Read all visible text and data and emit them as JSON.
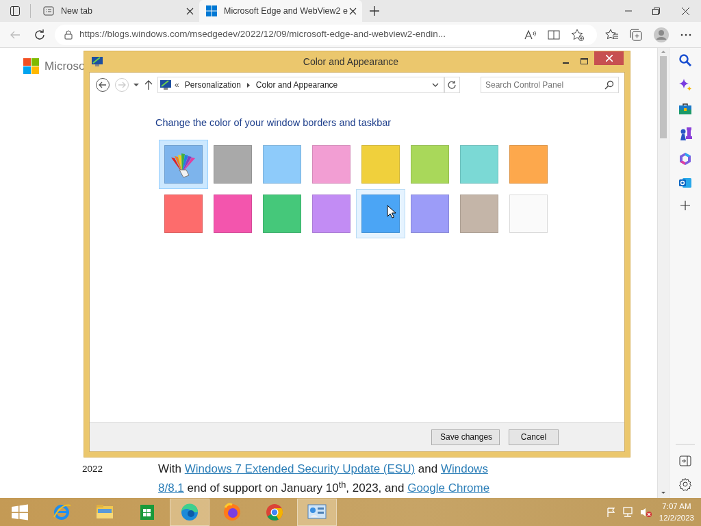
{
  "browser": {
    "tabs": [
      {
        "title": "New tab",
        "selected": false
      },
      {
        "title": "Microsoft Edge and WebView2 e",
        "selected": true
      }
    ],
    "url": "https://blogs.windows.com/msedgedev/2022/12/09/microsoft-edge-and-webview2-endin..."
  },
  "page": {
    "logo_text": "Microso",
    "date": "2022",
    "paragraph_lines": [
      [
        {
          "kind": "text",
          "text": "With "
        },
        {
          "kind": "link",
          "text": "Windows 7 Extended Security Update (ESU)"
        },
        {
          "kind": "text",
          "text": " and "
        },
        {
          "kind": "link",
          "text": "Windows"
        }
      ],
      [
        {
          "kind": "link",
          "text": "8/8.1"
        },
        {
          "kind": "text",
          "text": " end of support on January 10$^{th}$, 2023, and "
        },
        {
          "kind": "link",
          "text": "Google Chrome"
        }
      ]
    ]
  },
  "dialog": {
    "title": "Color and Appearance",
    "overflow": "«",
    "breadcrumb": [
      "Personalization",
      "Color and Appearance"
    ],
    "search": {
      "placeholder": "Search Control Panel"
    },
    "heading": "Change the color of your window borders and taskbar",
    "swatches": [
      {
        "kind": "custom",
        "selected": true,
        "hover": false
      },
      {
        "kind": "color",
        "color": "#a9a9a9",
        "selected": false,
        "hover": false
      },
      {
        "kind": "color",
        "color": "#8ecbfa",
        "selected": false,
        "hover": false
      },
      {
        "kind": "color",
        "color": "#f29ed3",
        "selected": false,
        "hover": false
      },
      {
        "kind": "color",
        "color": "#f0d03c",
        "selected": false,
        "hover": false
      },
      {
        "kind": "color",
        "color": "#a9d85a",
        "selected": false,
        "hover": false
      },
      {
        "kind": "color",
        "color": "#7bd9d5",
        "selected": false,
        "hover": false
      },
      {
        "kind": "color",
        "color": "#fda84c",
        "selected": false,
        "hover": false
      },
      {
        "kind": "color",
        "color": "#fd6c6c",
        "selected": false,
        "hover": false
      },
      {
        "kind": "color",
        "color": "#f355ad",
        "selected": false,
        "hover": false
      },
      {
        "kind": "color",
        "color": "#45c87a",
        "selected": false,
        "hover": false
      },
      {
        "kind": "color",
        "color": "#c28cf4",
        "selected": false,
        "hover": false
      },
      {
        "kind": "color",
        "color": "#4ba5f5",
        "selected": false,
        "hover": true
      },
      {
        "kind": "color",
        "color": "#9c9cf8",
        "selected": false,
        "hover": false
      },
      {
        "kind": "color",
        "color": "#c4b5a8",
        "selected": false,
        "hover": false
      },
      {
        "kind": "color",
        "color": "#fafafa",
        "selected": false,
        "hover": false
      }
    ],
    "buttons": [
      "Save changes",
      "Cancel"
    ]
  },
  "taskbar": {
    "apps": [
      {
        "kind": "ie",
        "active": false
      },
      {
        "kind": "explorer",
        "active": false
      },
      {
        "kind": "store",
        "active": false
      },
      {
        "kind": "edge",
        "active": true
      },
      {
        "kind": "firefox",
        "active": false
      },
      {
        "kind": "chrome",
        "active": false
      },
      {
        "kind": "control",
        "active": true
      }
    ],
    "time": "7:07 AM",
    "date": "12/2/2023"
  }
}
